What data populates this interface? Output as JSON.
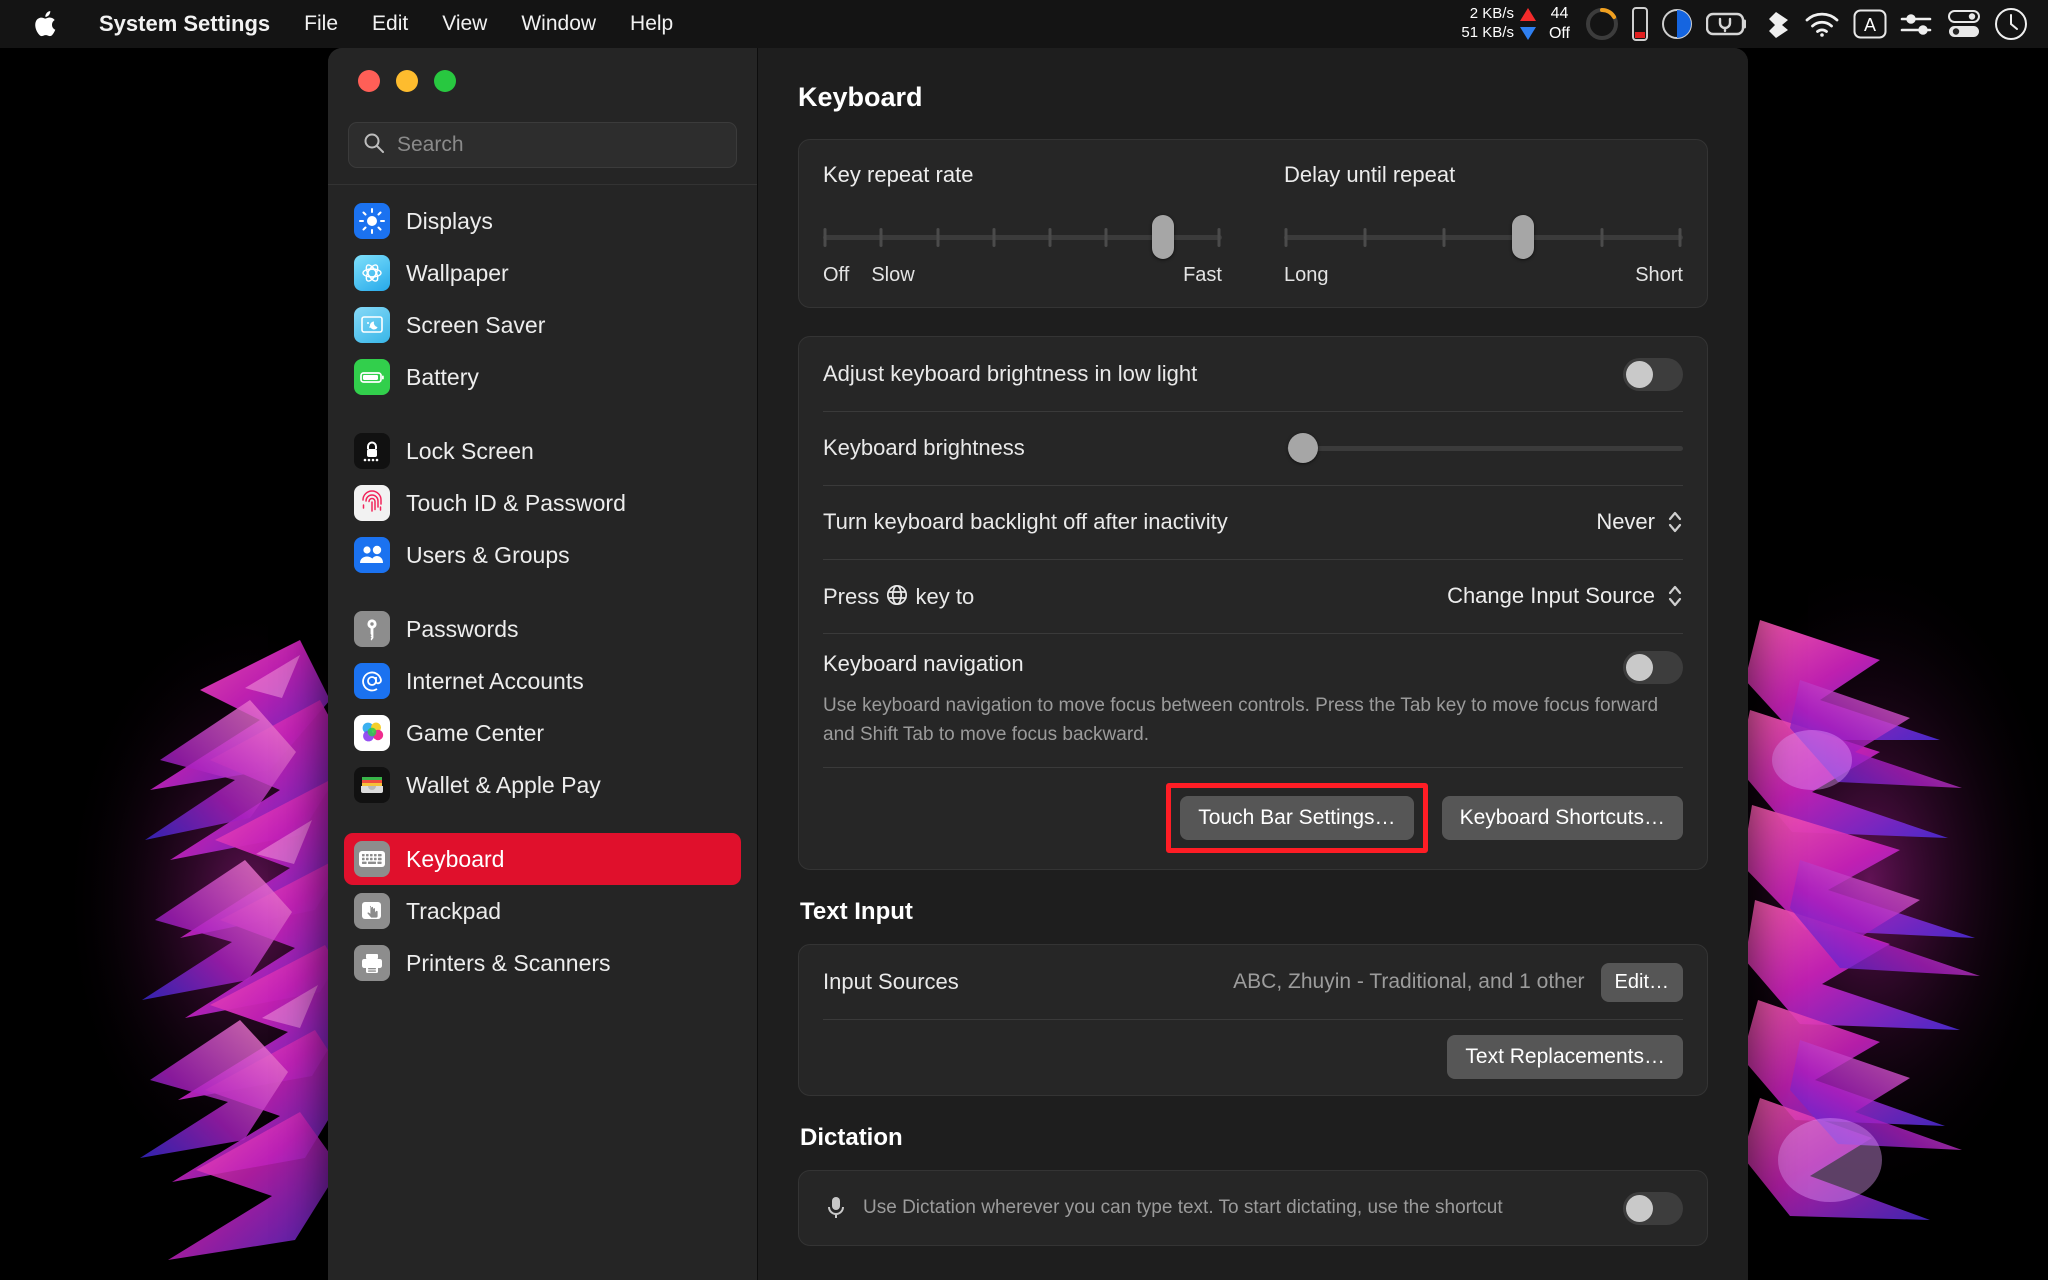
{
  "menubar": {
    "apple_icon": "apple-logo-icon",
    "items": [
      {
        "label": "System Settings",
        "bold": true
      },
      {
        "label": "File",
        "bold": false
      },
      {
        "label": "Edit",
        "bold": false
      },
      {
        "label": "View",
        "bold": false
      },
      {
        "label": "Window",
        "bold": false
      },
      {
        "label": "Help",
        "bold": false
      }
    ],
    "status": {
      "net_up": "2 KB/s",
      "net_down": "51 KB/s",
      "battery_percent": "44",
      "battery_state": "Off",
      "icons": [
        "activity-gauge-icon",
        "memory-bar-icon",
        "disk-pie-icon",
        "battery-charging-icon",
        "dropbox-icon",
        "wifi-icon",
        "input-source-abc-icon",
        "sliders-icon",
        "control-center-icon",
        "clock-icon"
      ]
    }
  },
  "window": {
    "traffic_lights": [
      "close",
      "minimize",
      "zoom"
    ],
    "search": {
      "placeholder": "Search",
      "value": "",
      "icon": "search-icon"
    }
  },
  "sidebar": {
    "groups": [
      {
        "items": [
          {
            "label": "Displays",
            "icon": "displays-icon",
            "selected": false
          },
          {
            "label": "Wallpaper",
            "icon": "wallpaper-icon",
            "selected": false
          },
          {
            "label": "Screen Saver",
            "icon": "screen-saver-icon",
            "selected": false
          },
          {
            "label": "Battery",
            "icon": "battery-icon",
            "selected": false
          }
        ]
      },
      {
        "items": [
          {
            "label": "Lock Screen",
            "icon": "lock-screen-icon",
            "selected": false
          },
          {
            "label": "Touch ID & Password",
            "icon": "touch-id-icon",
            "selected": false
          },
          {
            "label": "Users & Groups",
            "icon": "users-groups-icon",
            "selected": false
          }
        ]
      },
      {
        "items": [
          {
            "label": "Passwords",
            "icon": "passwords-key-icon",
            "selected": false
          },
          {
            "label": "Internet Accounts",
            "icon": "internet-accounts-at-icon",
            "selected": false
          },
          {
            "label": "Game Center",
            "icon": "game-center-icon",
            "selected": false
          },
          {
            "label": "Wallet & Apple Pay",
            "icon": "wallet-icon",
            "selected": false
          }
        ]
      },
      {
        "items": [
          {
            "label": "Keyboard",
            "icon": "keyboard-icon",
            "selected": true
          },
          {
            "label": "Trackpad",
            "icon": "trackpad-icon",
            "selected": false
          },
          {
            "label": "Printers & Scanners",
            "icon": "printer-icon",
            "selected": false
          }
        ]
      }
    ]
  },
  "main": {
    "title": "Keyboard",
    "key_repeat": {
      "label": "Key repeat rate",
      "ticks": 8,
      "value_index": 7,
      "end_left_a": "Off",
      "end_left_b": "Slow",
      "end_right": "Fast"
    },
    "delay_until_repeat": {
      "label": "Delay until repeat",
      "ticks": 6,
      "value_index": 4,
      "end_left": "Long",
      "end_right": "Short"
    },
    "adjust_brightness": {
      "label": "Adjust keyboard brightness in low light",
      "toggle_on": false
    },
    "keyboard_brightness": {
      "label": "Keyboard brightness",
      "percent": 4
    },
    "backlight_off": {
      "label": "Turn keyboard backlight off after inactivity",
      "value": "Never"
    },
    "globe_key": {
      "label_before": "Press",
      "label_after": "key to",
      "globe_icon": "globe-icon",
      "value": "Change Input Source"
    },
    "keyboard_navigation": {
      "title": "Keyboard navigation",
      "description": "Use keyboard navigation to move focus between controls. Press the Tab key to move focus forward and Shift Tab to move focus backward.",
      "toggle_on": false
    },
    "buttons": {
      "touch_bar": "Touch Bar Settings…",
      "keyboard_shortcuts": "Keyboard Shortcuts…"
    },
    "text_input": {
      "section_title": "Text Input",
      "input_sources_label": "Input Sources",
      "input_sources_value": "ABC, Zhuyin - Traditional, and 1 other",
      "edit_button": "Edit…",
      "text_replacements_button": "Text Replacements…"
    },
    "dictation": {
      "section_title": "Dictation",
      "description": "Use Dictation wherever you can type text. To start dictating, use the shortcut",
      "toggle_on": false
    }
  },
  "highlight": {
    "color": "#ff1d25",
    "target": "touch-bar-settings-button"
  }
}
